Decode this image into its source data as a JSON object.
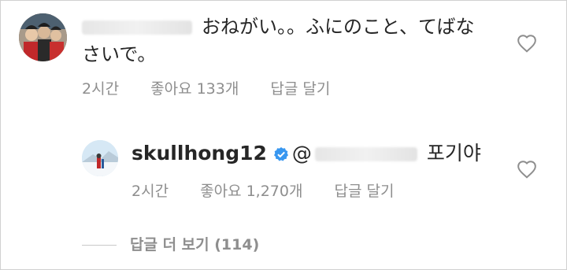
{
  "comment": {
    "text": "おねがい。。ふにのこと、てばなさいで。",
    "time": "2시간",
    "likes": "좋아요 133개",
    "reply_action": "답글 달기"
  },
  "reply": {
    "username": "skullhong12",
    "at": "@",
    "text": "포기야",
    "time": "2시간",
    "likes": "좋아요 1,270개",
    "reply_action": "답글 달기"
  },
  "view_more": "답글 더 보기 (114)",
  "icons": {
    "like": "heart-outline-icon",
    "verified": "verified-badge-icon"
  },
  "colors": {
    "text": "#262626",
    "muted": "#8e8e8e",
    "verified": "#3897f0"
  }
}
